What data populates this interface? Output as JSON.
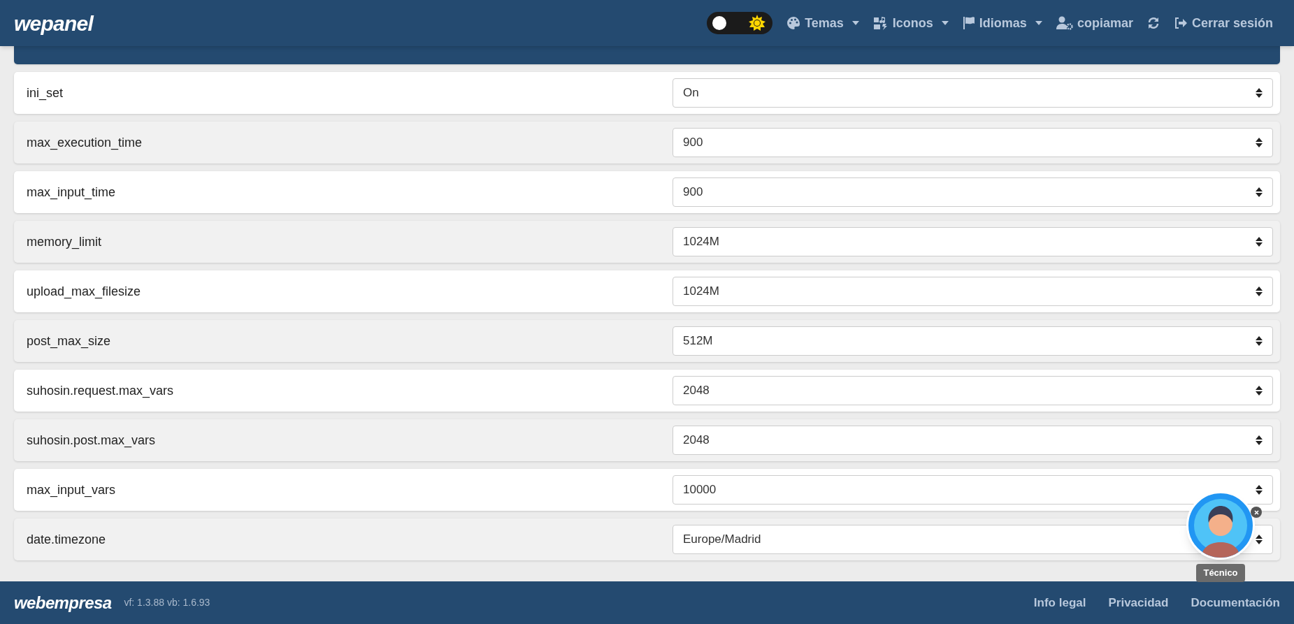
{
  "header": {
    "logo": "wepanel",
    "dark_mode": false,
    "menu": [
      {
        "kind": "palette",
        "label": "Temas",
        "dropdown": true
      },
      {
        "kind": "icons",
        "label": "Iconos",
        "dropdown": true
      },
      {
        "kind": "flag",
        "label": "Idiomas",
        "dropdown": true
      },
      {
        "kind": "user",
        "label": "copiamar",
        "dropdown": false
      },
      {
        "kind": "refresh",
        "dropdown": false
      },
      {
        "kind": "logout",
        "label": "Cerrar sesión",
        "dropdown": false
      }
    ]
  },
  "parameters": [
    {
      "name": "ini_set",
      "value": "On"
    },
    {
      "name": "max_execution_time",
      "value": "900"
    },
    {
      "name": "max_input_time",
      "value": "900"
    },
    {
      "name": "memory_limit",
      "value": "1024M"
    },
    {
      "name": "upload_max_filesize",
      "value": "1024M"
    },
    {
      "name": "post_max_size",
      "value": "512M"
    },
    {
      "name": "suhosin.request.max_vars",
      "value": "2048"
    },
    {
      "name": "suhosin.post.max_vars",
      "value": "2048"
    },
    {
      "name": "max_input_vars",
      "value": "10000"
    },
    {
      "name": "date.timezone",
      "value": "Europe/Madrid"
    }
  ],
  "assistant": {
    "label": "Técnico"
  },
  "footer": {
    "logo": "webempresa",
    "version": "vf: 1.3.88 vb: 1.6.93",
    "links": [
      "Info legal",
      "Privacidad",
      "Documentación"
    ]
  }
}
